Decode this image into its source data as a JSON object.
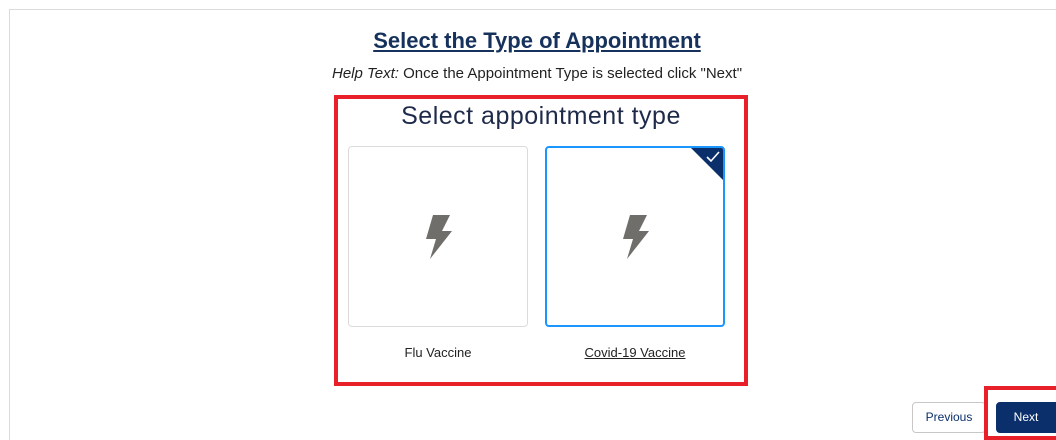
{
  "page": {
    "title": "Select the Type of Appointment",
    "help_label": "Help Text:",
    "help_text": " Once the Appointment Type is selected click \"Next\""
  },
  "selector": {
    "heading": "Select appointment type",
    "options": [
      {
        "label": "Flu Vaccine",
        "icon": "lightning-bolt-icon",
        "selected": false
      },
      {
        "label": "Covid-19 Vaccine",
        "icon": "lightning-bolt-icon",
        "selected": true
      }
    ]
  },
  "footer": {
    "previous_label": "Previous",
    "next_label": "Next"
  },
  "colors": {
    "title": "#16325c",
    "selected_border": "#1b96ff",
    "primary_button": "#0b2f6b",
    "annotation_red": "#e8202a",
    "icon_gray": "#706e6b"
  }
}
